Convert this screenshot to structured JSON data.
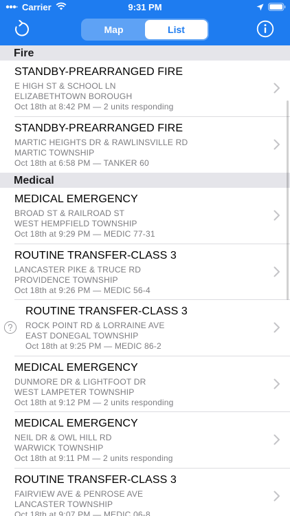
{
  "status_bar": {
    "carrier": "Carrier",
    "time": "9:31 PM",
    "icons": [
      "wifi-icon",
      "location-arrow-icon",
      "battery-icon"
    ]
  },
  "nav": {
    "refresh_icon": "refresh-icon",
    "info_icon": "info-icon",
    "segments": [
      {
        "label": "Map",
        "selected": false
      },
      {
        "label": "List",
        "selected": true
      }
    ]
  },
  "colors": {
    "header": "#1e7cf0",
    "section_header": "#e5e5ea",
    "subtitle_text": "#7c7c80"
  },
  "sections": [
    {
      "title": "Fire",
      "incidents": [
        {
          "type": "STANDBY-PREARRANGED FIRE",
          "location": "E HIGH ST & SCHOOL LN",
          "municipality": "ELIZABETHTOWN BOROUGH",
          "date": "Oct 18th at 8:42 PM",
          "units": "2 units responding"
        },
        {
          "type": "STANDBY-PREARRANGED FIRE",
          "location": "MARTIC HEIGHTS DR & RAWLINSVILLE RD",
          "municipality": "MARTIC TOWNSHIP",
          "date": "Oct 18th at 6:58 PM",
          "units": "TANKER 60"
        }
      ]
    },
    {
      "title": "Medical",
      "incidents": [
        {
          "type": "MEDICAL EMERGENCY",
          "location": "BROAD ST & RAILROAD ST",
          "municipality": "WEST HEMPFIELD TOWNSHIP",
          "date": "Oct 18th at 9:29 PM",
          "units": "MEDIC 77-31"
        },
        {
          "type": "ROUTINE TRANSFER-CLASS 3",
          "location": "LANCASTER PIKE & TRUCE RD",
          "municipality": "PROVIDENCE TOWNSHIP",
          "date": "Oct 18th at 9:26 PM",
          "units": "MEDIC 56-4"
        },
        {
          "type": "ROUTINE TRANSFER-CLASS 3",
          "location": "ROCK POINT RD & LORRAINE AVE",
          "municipality": "EAST DONEGAL TOWNSHIP",
          "date": "Oct 18th at 9:25 PM",
          "units": "MEDIC 86-2",
          "flag_icon": "question-circle-icon"
        },
        {
          "type": "MEDICAL EMERGENCY",
          "location": "DUNMORE DR & LIGHTFOOT DR",
          "municipality": "WEST LAMPETER TOWNSHIP",
          "date": "Oct 18th at 9:12 PM",
          "units": "2 units responding"
        },
        {
          "type": "MEDICAL EMERGENCY",
          "location": "NEIL DR & OWL HILL RD",
          "municipality": "WARWICK TOWNSHIP",
          "date": "Oct 18th at 9:11 PM",
          "units": "2 units responding"
        },
        {
          "type": "ROUTINE TRANSFER-CLASS 3",
          "location": "FAIRVIEW AVE & PENROSE AVE",
          "municipality": "LANCASTER TOWNSHIP",
          "date": "Oct 18th at 9:07 PM",
          "units": "MEDIC 06-8"
        }
      ]
    }
  ],
  "separator": "—"
}
